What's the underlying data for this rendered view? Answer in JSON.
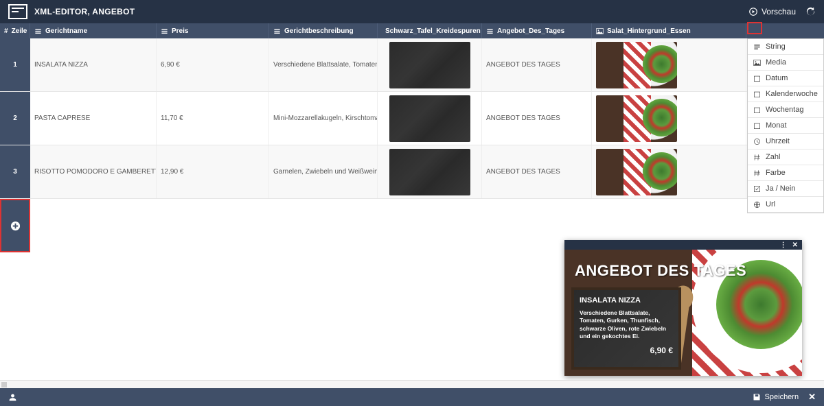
{
  "header": {
    "title": "XML-EDITOR, ANGEBOT",
    "preview_btn": "Vorschau"
  },
  "columns": {
    "zeile": "Zeile",
    "gerichtname": "Gerichtname",
    "preis": "Preis",
    "gerichtbeschreibung": "Gerichtbeschreibung",
    "schwarz_tafel": "Schwarz_Tafel_Kreidespuren",
    "angebot_des_tages": "Angebot_Des_Tages",
    "salat_hintergrund": "Salat_Hintergrund_Essen"
  },
  "rows": [
    {
      "num": "1",
      "name": "INSALATA NIZZA",
      "preis": "6,90 €",
      "besch": "Verschiedene Blattsalate, Tomaten, Gurk",
      "angebot": "ANGEBOT DES TAGES"
    },
    {
      "num": "2",
      "name": "PASTA CAPRESE",
      "preis": "11,70 €",
      "besch": "Mini-Mozzarellakugeln, Kirschtomaten, P",
      "angebot": "ANGEBOT DES TAGES"
    },
    {
      "num": "3",
      "name": "RISOTTO POMODORO E GAMBERETTI",
      "preis": "12,90 €",
      "besch": "Garnelen, Zwiebeln und Weißwein in Tor",
      "angebot": "ANGEBOT DES TAGES"
    }
  ],
  "dropdown": {
    "items": [
      "String",
      "Media",
      "Datum",
      "Kalenderwoche",
      "Wochentag",
      "Monat",
      "Uhrzeit",
      "Zahl",
      "Farbe",
      "Ja / Nein",
      "Url"
    ]
  },
  "preview": {
    "headline": "ANGEBOT DES TAGES",
    "dish": "INSALATA NIZZA",
    "desc": "Verschiedene Blattsalate, Tomaten, Gurken, Thunfisch, schwarze Oliven, rote Zwiebeln und ein gekochtes Ei.",
    "price": "6,90 €"
  },
  "footer": {
    "save": "Speichern"
  }
}
